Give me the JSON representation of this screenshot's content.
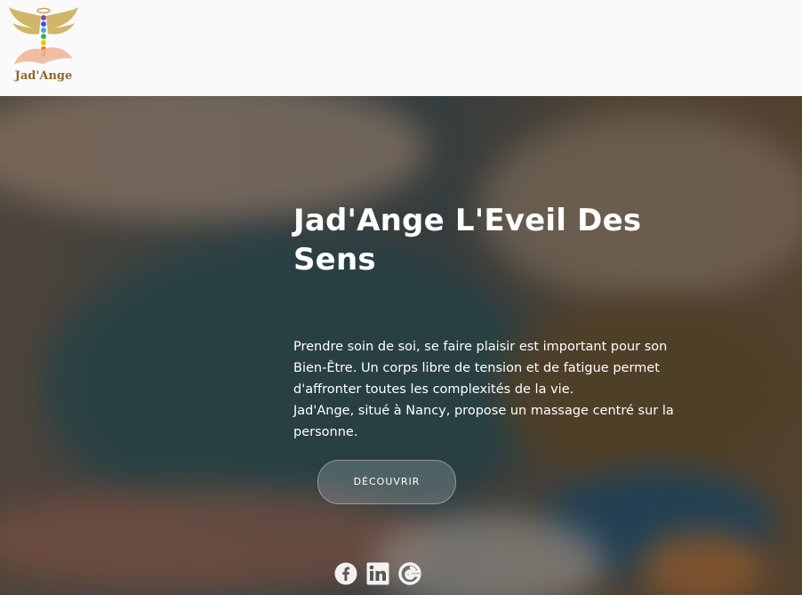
{
  "header": {
    "logo_text": "Jad'Ange"
  },
  "hero": {
    "title": "Jad'Ange L'Eveil Des Sens",
    "paragraph_1": "Prendre soin de soi, se faire plaisir est important pour son Bien-Être. Un corps libre de tension et de fatigue permet d'affronter toutes les complexités de la vie.",
    "paragraph_2": "Jad'Ange, situé à Nancy, propose un massage centré sur la personne.",
    "button_label": "DÉCOUVRIR"
  },
  "social": {
    "icons": [
      "facebook-icon",
      "linkedin-icon",
      "google-icon"
    ]
  },
  "colors": {
    "header_bg": "#fafafa",
    "text_light": "#ffffff",
    "logo_gold": "#b8964a"
  }
}
